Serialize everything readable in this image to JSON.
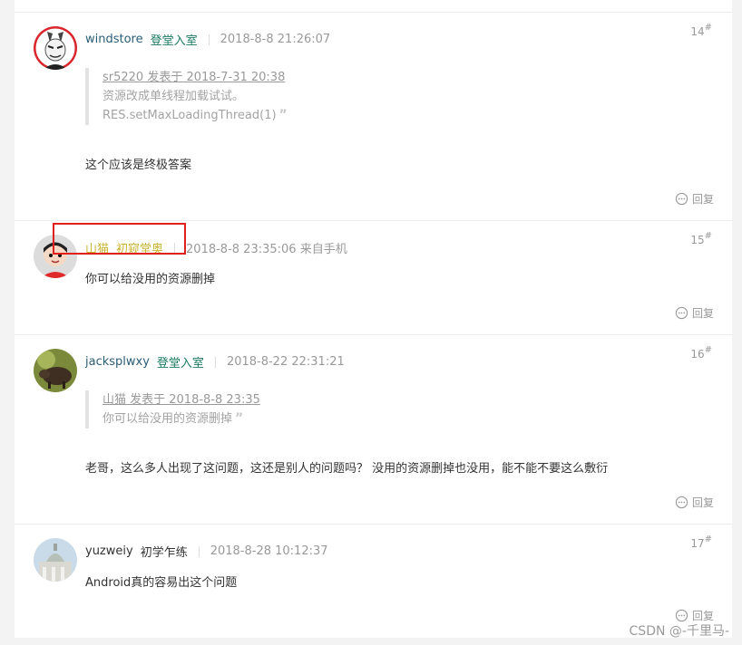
{
  "posts": [
    {
      "user": "windstore",
      "level": "登堂入室",
      "time": "2018-8-8 21:26:07",
      "floor": "14",
      "quote_head": "sr5220 发表于 2018-7-31 20:38",
      "quote_lines": [
        "资源改成单线程加载试试。",
        "RES.setMaxLoadingThread(1)"
      ],
      "content": "这个应该是终极答案",
      "reply": "回复"
    },
    {
      "user": "山猫",
      "level": "初窥堂奥",
      "time": "2018-8-8 23:35:06 来自手机",
      "floor": "15",
      "content": "你可以给没用的资源删掉",
      "reply": "回复"
    },
    {
      "user": "jacksplwxy",
      "level": "登堂入室",
      "time": "2018-8-22 22:31:21",
      "floor": "16",
      "quote_head": "山猫 发表于 2018-8-8 23:35",
      "quote_lines": [
        "你可以给没用的资源删掉"
      ],
      "content": "老哥，这么多人出现了这问题，这还是别人的问题吗？ 没用的资源删掉也没用，能不能不要这么敷衍",
      "reply": "回复"
    },
    {
      "user": "yuzweiy",
      "level": "初学乍练",
      "time": "2018-8-28 10:12:37",
      "floor": "17",
      "content": "Android真的容易出这个问题",
      "reply": "回复"
    }
  ],
  "floor_mark": "#",
  "quote_mark": "”",
  "watermark": "CSDN @-千里马-",
  "colors": {
    "highlight": "#e0201c",
    "username": "#2a5d76",
    "level": "#1a7a62",
    "highlight_username": "#c9b32f"
  }
}
